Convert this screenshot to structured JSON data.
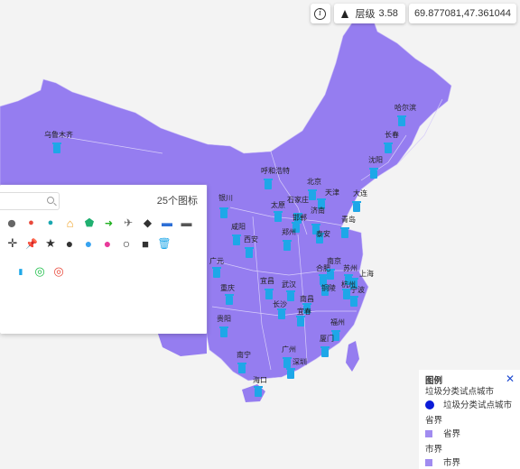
{
  "toolbar": {
    "info_icon": "info-icon",
    "zoom_label": "层级",
    "zoom_value": "3.58",
    "coordinates": "69.877081,47.361044"
  },
  "icon_panel": {
    "count_text": "25个图标",
    "rows": [
      [
        "map-pin-icon",
        "red-pin-icon",
        "teal-pin-icon",
        "house-icon",
        "home-icon",
        "arrow-circle-icon",
        "plane-icon",
        "diamond-icon",
        "car-icon",
        "car-front-icon"
      ],
      [
        "crosshair-icon",
        "push-pin-icon",
        "star-icon",
        "circle-icon",
        "blue-dot-icon",
        "pink-dot-icon",
        "ring-icon",
        "square-icon",
        "trash-bin-icon"
      ],
      [
        "trash-can-icon",
        "target-green-icon",
        "target-red-icon"
      ]
    ]
  },
  "cities": [
    {
      "name": "乌鲁木齐"
    },
    {
      "name": "哈尔滨"
    },
    {
      "name": "长春"
    },
    {
      "name": "沈阳"
    },
    {
      "name": "呼和浩特"
    },
    {
      "name": "北京"
    },
    {
      "name": "天津"
    },
    {
      "name": "大连"
    },
    {
      "name": "银川"
    },
    {
      "name": "太原"
    },
    {
      "name": "石家庄"
    },
    {
      "name": "邯郸"
    },
    {
      "name": "济南"
    },
    {
      "name": "泰安"
    },
    {
      "name": "青岛"
    },
    {
      "name": "咸阳"
    },
    {
      "name": "西安"
    },
    {
      "name": "郑州"
    },
    {
      "name": "南京"
    },
    {
      "name": "苏州"
    },
    {
      "name": "上海"
    },
    {
      "name": "合肥"
    },
    {
      "name": "铜陵"
    },
    {
      "name": "杭州"
    },
    {
      "name": "宁波"
    },
    {
      "name": "广元"
    },
    {
      "name": "重庆"
    },
    {
      "name": "宜昌"
    },
    {
      "name": "武汉"
    },
    {
      "name": "长沙"
    },
    {
      "name": "南昌"
    },
    {
      "name": "宜春"
    },
    {
      "name": "贵阳"
    },
    {
      "name": "福州"
    },
    {
      "name": "厦门"
    },
    {
      "name": "南宁"
    },
    {
      "name": "广州"
    },
    {
      "name": "深圳"
    },
    {
      "name": "海口"
    }
  ],
  "legend": {
    "title": "图例",
    "layer1": "垃圾分类试点城市",
    "layer1_item": "垃圾分类试点城市",
    "layer2": "省界",
    "layer2_item": "省界",
    "layer3": "市界",
    "layer3_item": "市界",
    "point_color": "#0b1bd8",
    "area_color": "#a18cf0"
  },
  "colors": {
    "land": "#957df0",
    "background": "#f3f3f3",
    "marker": "#1ea7e8"
  }
}
